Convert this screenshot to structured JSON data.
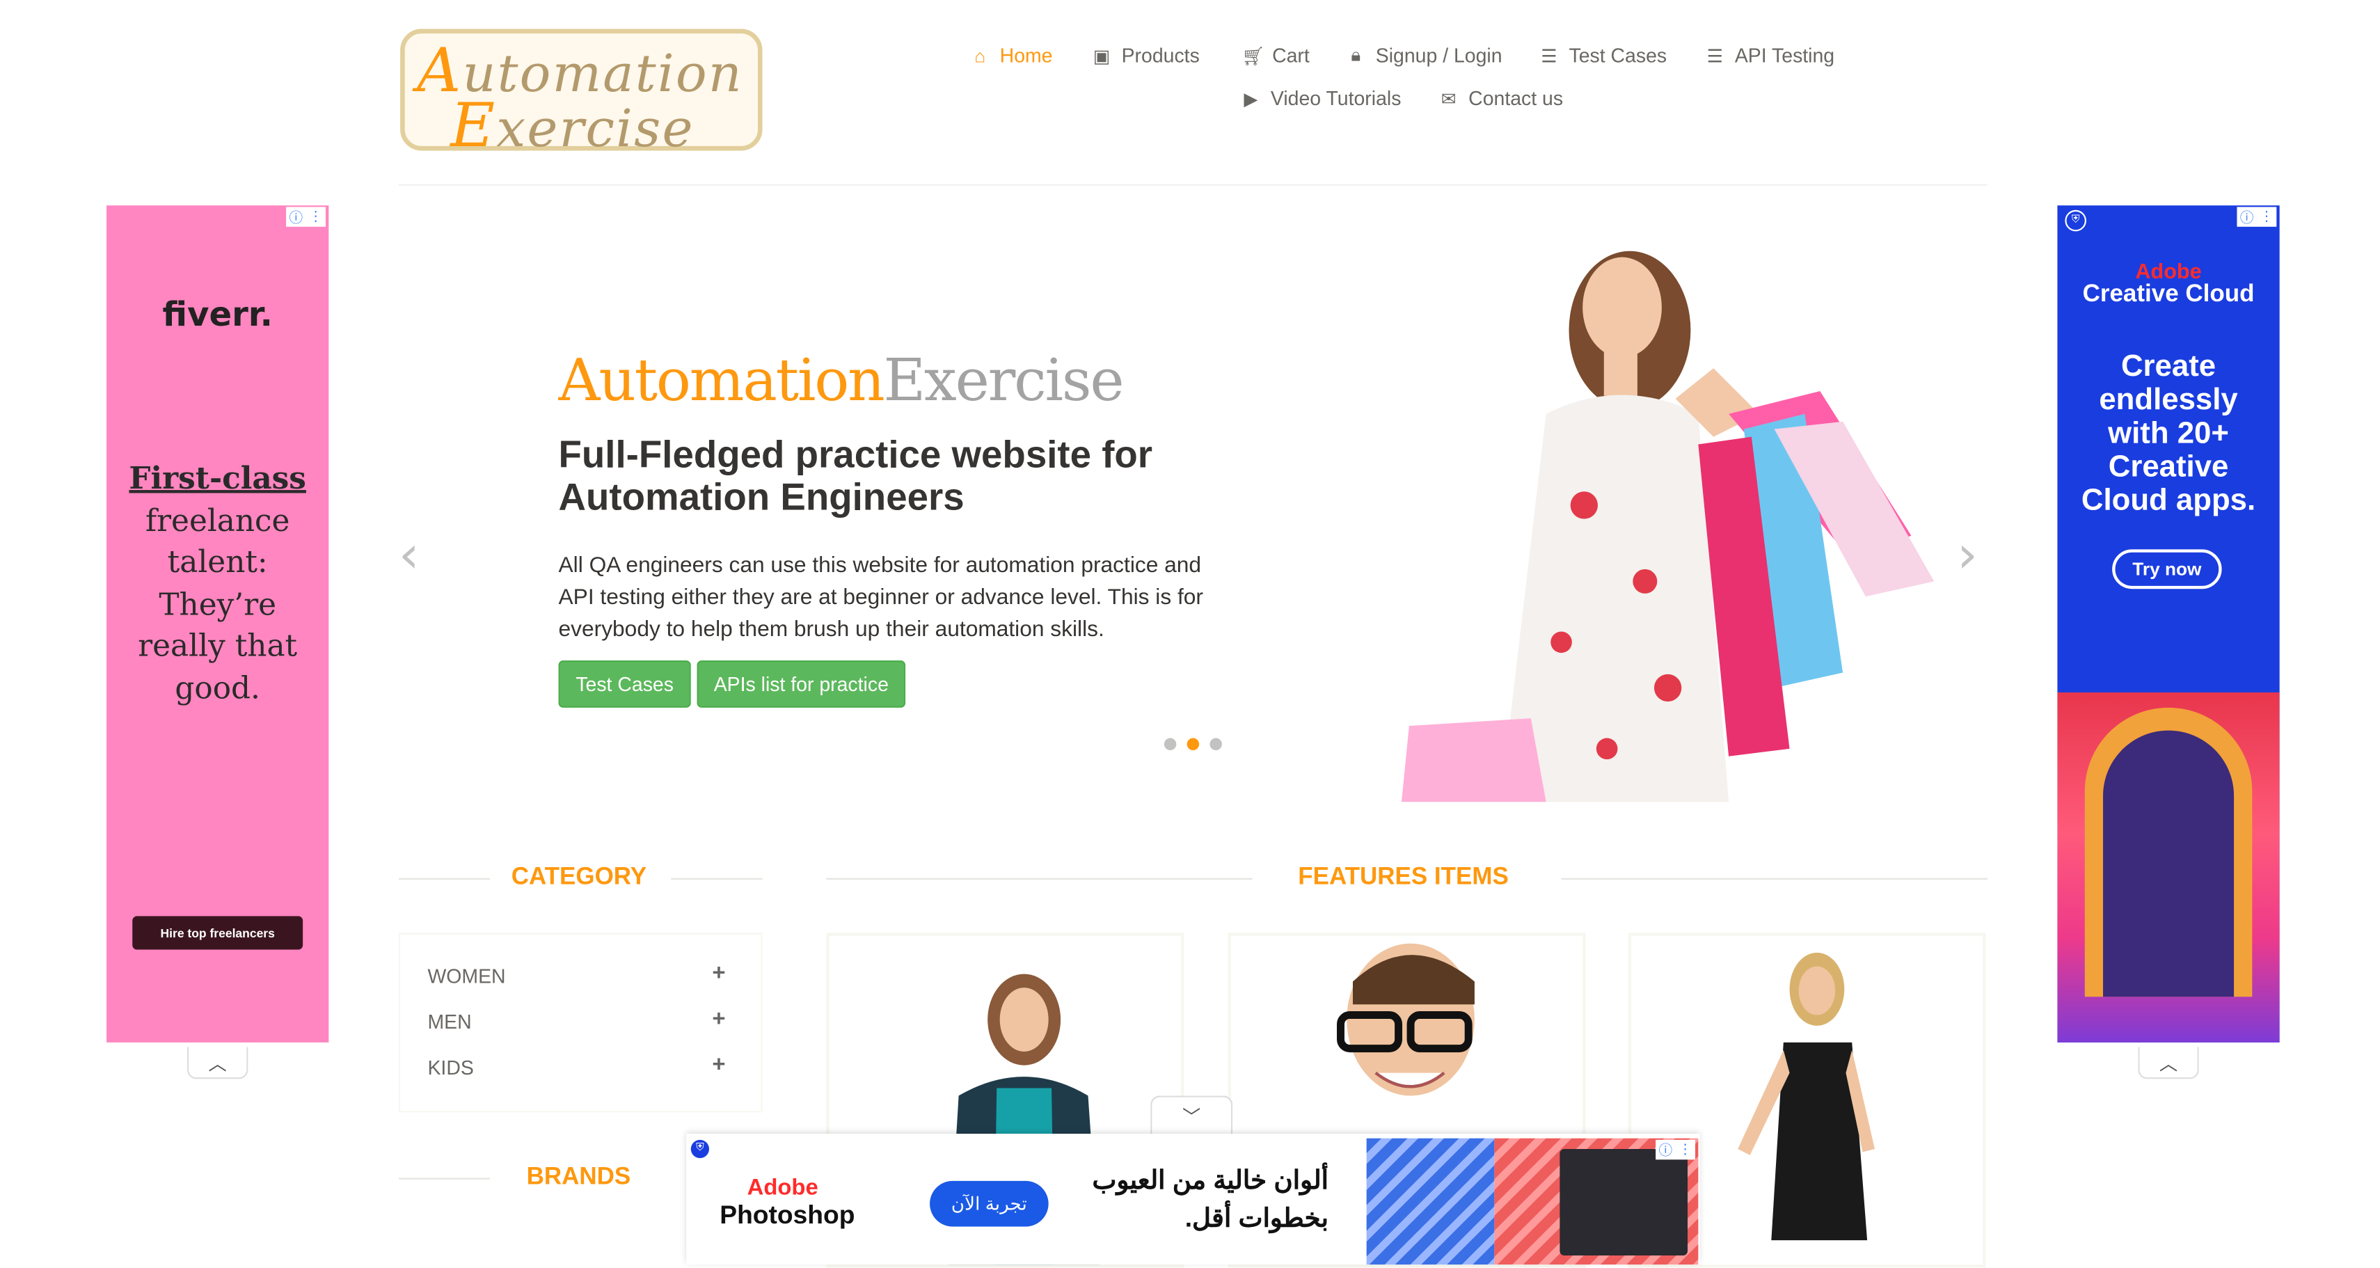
{
  "logo": {
    "line1_cap": "A",
    "line1_rest": "utomation",
    "line2_cap": "E",
    "line2_rest": "xercise"
  },
  "nav": {
    "home": {
      "icon": "home-icon",
      "label": "Home"
    },
    "products": {
      "icon": "briefcase-icon",
      "label": "Products"
    },
    "cart": {
      "icon": "cart-icon",
      "label": "Cart"
    },
    "signup": {
      "icon": "lock-icon",
      "label": "Signup / Login"
    },
    "test_cases": {
      "icon": "list-icon",
      "label": "Test Cases"
    },
    "api_testing": {
      "icon": "list-icon",
      "label": "API Testing"
    },
    "video": {
      "icon": "youtube-icon",
      "label": "Video Tutorials"
    },
    "contact": {
      "icon": "envelope-icon",
      "label": "Contact us"
    }
  },
  "ad_left": {
    "brand": "fiverr.",
    "underline": "First-class",
    "body": "freelance talent: They’re really that good.",
    "cta": "Hire top freelancers",
    "color": "#ff86c0"
  },
  "ad_right": {
    "brand1": "Adobe",
    "brand2": "Creative Cloud",
    "headline": "Create endlessly with 20+ Creative Cloud apps.",
    "cta": "Try now",
    "color": "#1a3de0"
  },
  "hero": {
    "title_a": "Automation",
    "title_b": "Exercise",
    "heading": "Full-Fledged practice website for Automation Engineers",
    "text": "All QA engineers can use this website for automation practice and API testing either they are at beginner or advance level. This is for everybody to help them brush up their automation skills.",
    "btn_test_cases": "Test Cases",
    "btn_apis": "APIs list for practice",
    "prev": "‹",
    "next": "›",
    "active_slide": 2,
    "slide_count": 3
  },
  "sidebar": {
    "category_title": "CATEGORY",
    "categories": [
      "WOMEN",
      "MEN",
      "KIDS"
    ],
    "brands_title": "BRANDS"
  },
  "features": {
    "title": "FEATURES ITEMS"
  },
  "ad_bottom": {
    "brand1": "Adobe",
    "brand2": "Photoshop",
    "cta": "تجربة الآن",
    "text": "ألوان خالية من العيوب بخطوات أقل."
  },
  "colors": {
    "accent": "#fe980f",
    "button": "#5cb85c"
  }
}
